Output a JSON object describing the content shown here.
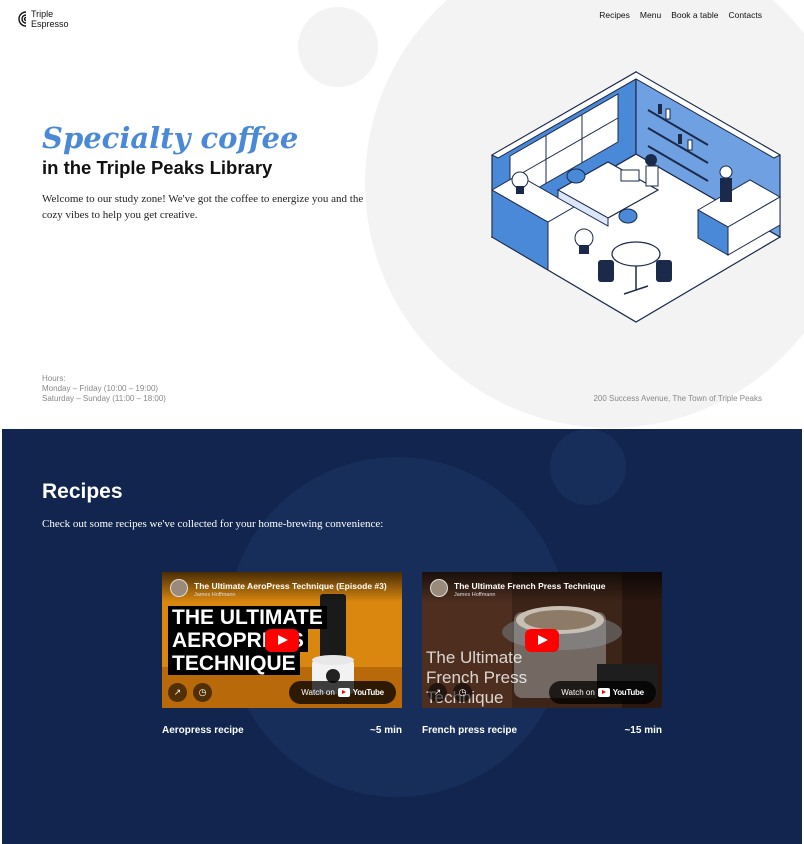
{
  "brand": {
    "line1": "Triple",
    "line2": "Espresso"
  },
  "nav": {
    "items": [
      "Recipes",
      "Menu",
      "Book a table",
      "Contacts"
    ]
  },
  "hero": {
    "title": "Specialty coffee",
    "subtitle": "in the Triple Peaks Library",
    "description": "Welcome to our study zone! We've got the coffee to energize you and the cozy vibes to help you get creative.",
    "hours_label": "Hours:",
    "hours_weekday": "Monday – Friday (10:00 – 19:00)",
    "hours_weekend": "Saturday – Sunday (11:00 – 18:00)",
    "address": "200 Success Avenue, The Town of Triple Peaks"
  },
  "recipes": {
    "title": "Recipes",
    "description": "Check out some recipes we've collected for your home-brewing convenience:",
    "videos": [
      {
        "title": "The Ultimate AeroPress Technique (Episode #3)",
        "author": "James Hoffmann",
        "overlay_lines": [
          "THE ULTIMATE",
          "AEROPRESS",
          "TECHNIQUE"
        ],
        "watch_on": "Watch on",
        "youtube": "YouTube",
        "caption": "Aeropress recipe",
        "duration": "~5 min"
      },
      {
        "title": "The Ultimate French Press Technique",
        "author": "James Hoffmann",
        "overlay_lines": [
          "The Ultimate",
          "French Press",
          "Technique"
        ],
        "watch_on": "Watch on",
        "youtube": "YouTube",
        "caption": "French press recipe",
        "duration": "~15 min"
      }
    ]
  },
  "colors": {
    "accent_blue": "#4a89d8",
    "recipes_bg": "#11254e",
    "youtube_red": "#ff0000"
  }
}
